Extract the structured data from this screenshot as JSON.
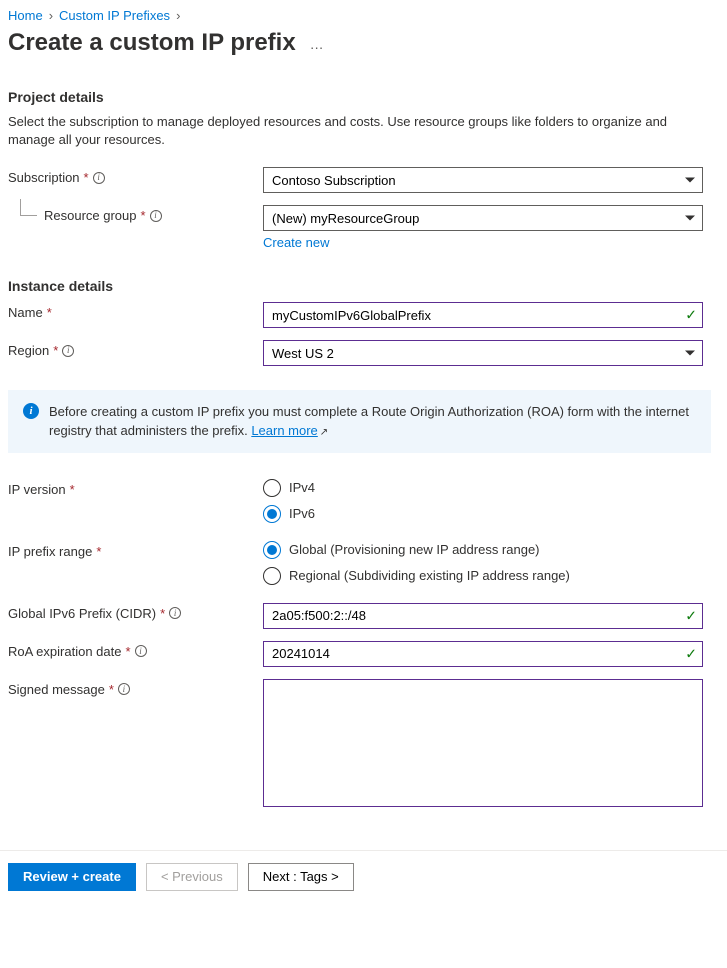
{
  "breadcrumb": {
    "home": "Home",
    "section": "Custom IP Prefixes"
  },
  "page_title": "Create a custom IP prefix",
  "project_details": {
    "heading": "Project details",
    "description": "Select the subscription to manage deployed resources and costs. Use resource groups like folders to organize and manage all your resources.",
    "subscription_label": "Subscription",
    "subscription_value": "Contoso Subscription",
    "resource_group_label": "Resource group",
    "resource_group_value": "(New) myResourceGroup",
    "create_new": "Create new"
  },
  "instance_details": {
    "heading": "Instance details",
    "name_label": "Name",
    "name_value": "myCustomIPv6GlobalPrefix",
    "region_label": "Region",
    "region_value": "West US 2"
  },
  "info_banner": {
    "text": "Before creating a custom IP prefix you must complete a Route Origin Authorization (ROA) form with the internet registry that administers the prefix. ",
    "learn_more": "Learn more"
  },
  "ip_version": {
    "label": "IP version",
    "options": {
      "ipv4": "IPv4",
      "ipv6": "IPv6"
    },
    "selected": "ipv6"
  },
  "ip_prefix_range": {
    "label": "IP prefix range",
    "options": {
      "global": "Global (Provisioning new IP address range)",
      "regional": "Regional (Subdividing existing IP address range)"
    },
    "selected": "global"
  },
  "global_prefix": {
    "label": "Global IPv6 Prefix (CIDR)",
    "value": "2a05:f500:2::/48"
  },
  "roa_expiration": {
    "label": "RoA expiration date",
    "value": "20241014"
  },
  "signed_message": {
    "label": "Signed message",
    "value": ""
  },
  "footer": {
    "review": "Review + create",
    "previous": "< Previous",
    "next": "Next : Tags >"
  }
}
